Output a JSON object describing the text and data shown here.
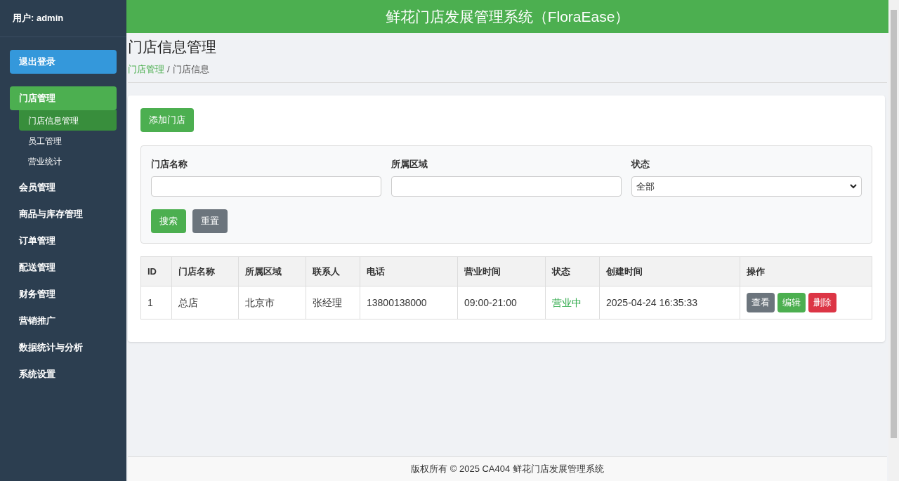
{
  "sidebar": {
    "user": "用户: admin",
    "logout": "退出登录",
    "items": [
      {
        "label": "门店管理",
        "selected": true,
        "children": [
          {
            "label": "门店信息管理",
            "selected": true
          },
          {
            "label": "员工管理",
            "selected": false
          },
          {
            "label": "营业统计",
            "selected": false
          }
        ]
      },
      {
        "label": "会员管理",
        "selected": false
      },
      {
        "label": "商品与库存管理",
        "selected": false
      },
      {
        "label": "订单管理",
        "selected": false
      },
      {
        "label": "配送管理",
        "selected": false
      },
      {
        "label": "财务管理",
        "selected": false
      },
      {
        "label": "营销推广",
        "selected": false
      },
      {
        "label": "数据统计与分析",
        "selected": false
      },
      {
        "label": "系统设置",
        "selected": false
      }
    ]
  },
  "header": {
    "title": "鲜花门店发展管理系统（FloraEase）"
  },
  "page": {
    "title": "门店信息管理",
    "breadcrumb": [
      "门店管理",
      "门店信息"
    ],
    "breadcrumb_separator": "/"
  },
  "add_button": "添加门店",
  "filters": {
    "fields": [
      {
        "kind": "text",
        "label": "门店名称"
      },
      {
        "kind": "text",
        "label": "所属区域"
      },
      {
        "kind": "select",
        "label": "状态",
        "value": "全部"
      }
    ],
    "buttons": [
      {
        "kind": "success",
        "label": "搜索"
      },
      {
        "kind": "secondary",
        "label": "重置"
      }
    ]
  },
  "table": {
    "columns": [
      "ID",
      "门店名称",
      "所属区域",
      "联系人",
      "电话",
      "营业时间",
      "状态",
      "创建时间",
      "操作"
    ],
    "rows": [
      {
        "cells": [
          "1",
          "总店",
          "北京市",
          "张经理",
          "13800138000",
          "09:00-21:00"
        ],
        "status": {
          "text": "营业中",
          "color": "#28a745"
        },
        "created": "2025-04-24 16:35:33",
        "actions": [
          {
            "kind": "secondary",
            "label": "查看"
          },
          {
            "kind": "success",
            "label": "编辑"
          },
          {
            "kind": "danger",
            "label": "删除"
          }
        ]
      }
    ]
  },
  "footer": "版权所有 © 2025 CA404 鲜花门店发展管理系统"
}
